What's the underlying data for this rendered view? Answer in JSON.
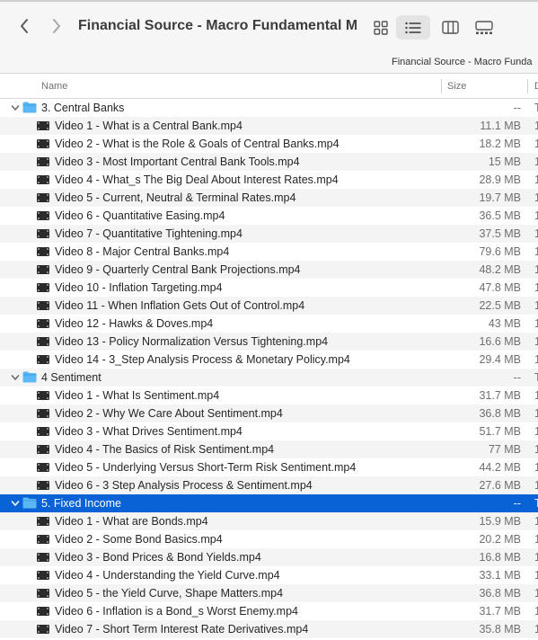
{
  "toolbar": {
    "title": "Financial Source - Macro Fundamental M...",
    "back_icon": "chevron-left-icon",
    "forward_icon": "chevron-right-icon",
    "views": [
      "icon-view-icon",
      "list-view-icon",
      "column-view-icon",
      "gallery-view-icon"
    ],
    "active_view": "list"
  },
  "pathbar": {
    "text": "Financial Source - Macro Funda"
  },
  "columns": {
    "name": "Name",
    "size": "Size",
    "kind": "D"
  },
  "colors": {
    "selection": "#0a63d6",
    "folder": "#5bb8f5",
    "alt_row": "#f4f4f4"
  },
  "rows": [
    {
      "type": "folder",
      "name": "3. Central Banks",
      "size": "--",
      "kind": "T",
      "expanded": true
    },
    {
      "type": "file",
      "name": "Video 1 - What is a Central Bank.mp4",
      "size": "11.1 MB",
      "kind": "1"
    },
    {
      "type": "file",
      "name": "Video 2 - What is the Role & Goals of Central Banks.mp4",
      "size": "18.2 MB",
      "kind": "1"
    },
    {
      "type": "file",
      "name": "Video 3 - Most Important Central Bank Tools.mp4",
      "size": "15 MB",
      "kind": "1"
    },
    {
      "type": "file",
      "name": "Video 4 - What_s The Big Deal About Interest Rates.mp4",
      "size": "28.9 MB",
      "kind": "1"
    },
    {
      "type": "file",
      "name": "Video 5 - Current, Neutral & Terminal Rates.mp4",
      "size": "19.7 MB",
      "kind": "1"
    },
    {
      "type": "file",
      "name": "Video 6 - Quantitative Easing.mp4",
      "size": "36.5 MB",
      "kind": "1"
    },
    {
      "type": "file",
      "name": "Video 7 - Quantitative Tightening.mp4",
      "size": "37.5 MB",
      "kind": "1"
    },
    {
      "type": "file",
      "name": "Video 8 - Major Central Banks.mp4",
      "size": "79.6 MB",
      "kind": "1"
    },
    {
      "type": "file",
      "name": "Video 9 - Quarterly Central Bank Projections.mp4",
      "size": "48.2 MB",
      "kind": "1"
    },
    {
      "type": "file",
      "name": "Video 10 - Inflation Targeting.mp4",
      "size": "47.8 MB",
      "kind": "1"
    },
    {
      "type": "file",
      "name": "Video 11 - When Inflation Gets Out of Control.mp4",
      "size": "22.5 MB",
      "kind": "1"
    },
    {
      "type": "file",
      "name": "Video 12 - Hawks & Doves.mp4",
      "size": "43 MB",
      "kind": "1"
    },
    {
      "type": "file",
      "name": "Video 13 - Policy Normalization Versus Tightening.mp4",
      "size": "16.6 MB",
      "kind": "1"
    },
    {
      "type": "file",
      "name": "Video 14 - 3_Step Analysis Process & Monetary Policy.mp4",
      "size": "29.4 MB",
      "kind": "1"
    },
    {
      "type": "folder",
      "name": "4 Sentiment",
      "size": "--",
      "kind": "T",
      "expanded": true
    },
    {
      "type": "file",
      "name": "Video 1 - What Is Sentiment.mp4",
      "size": "31.7 MB",
      "kind": "1"
    },
    {
      "type": "file",
      "name": "Video 2 - Why We Care About Sentiment.mp4",
      "size": "36.8 MB",
      "kind": "1"
    },
    {
      "type": "file",
      "name": "Video 3 - What Drives Sentiment.mp4",
      "size": "51.7 MB",
      "kind": "1"
    },
    {
      "type": "file",
      "name": "Video 4 - The Basics of Risk Sentiment.mp4",
      "size": "77 MB",
      "kind": "1"
    },
    {
      "type": "file",
      "name": "Video 5 - Underlying Versus Short-Term Risk Sentiment.mp4",
      "size": "44.2 MB",
      "kind": "1"
    },
    {
      "type": "file",
      "name": "Video 6 - 3 Step Analysis Process & Sentiment.mp4",
      "size": "27.6 MB",
      "kind": "1"
    },
    {
      "type": "folder",
      "name": "5. Fixed Income",
      "size": "--",
      "kind": "T",
      "expanded": true,
      "selected": true
    },
    {
      "type": "file",
      "name": "Video 1 - What are Bonds.mp4",
      "size": "15.9 MB",
      "kind": "1"
    },
    {
      "type": "file",
      "name": "Video 2 - Some Bond Basics.mp4",
      "size": "20.2 MB",
      "kind": "1"
    },
    {
      "type": "file",
      "name": "Video 3 - Bond Prices & Bond Yields.mp4",
      "size": "16.8 MB",
      "kind": "1"
    },
    {
      "type": "file",
      "name": "Video 4 - Understanding the Yield Curve.mp4",
      "size": "33.1 MB",
      "kind": "1"
    },
    {
      "type": "file",
      "name": "Video 5 - the Yield Curve, Shape Matters.mp4",
      "size": "36.8 MB",
      "kind": "1"
    },
    {
      "type": "file",
      "name": "Video 6 - Inflation is a Bond_s Worst Enemy.mp4",
      "size": "31.7 MB",
      "kind": "1"
    },
    {
      "type": "file",
      "name": "Video 7 - Short Term Interest Rate Derivatives.mp4",
      "size": "35.8 MB",
      "kind": "1"
    }
  ]
}
